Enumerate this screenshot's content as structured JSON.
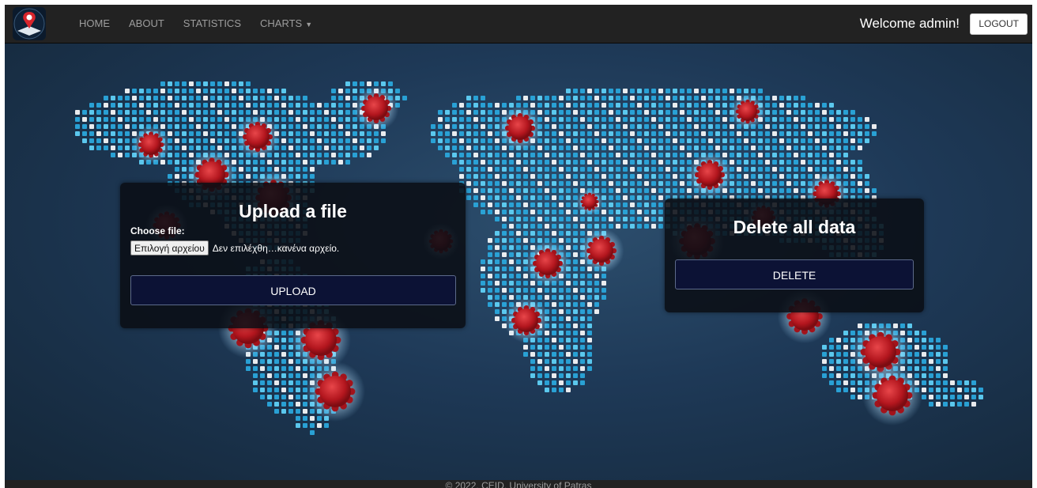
{
  "navbar": {
    "logo_label": "logo",
    "links": [
      {
        "label": "HOME"
      },
      {
        "label": "ABOUT"
      },
      {
        "label": "STATISTICS"
      },
      {
        "label": "CHARTS"
      }
    ],
    "welcome": "Welcome admin!",
    "logout_label": "LOGOUT"
  },
  "upload": {
    "title": "Upload a file",
    "choose_label": "Choose file:",
    "file_button": "Επιλογή αρχείου",
    "file_status": "Δεν επιλέχθη…κανένα αρχείο.",
    "submit_label": "UPLOAD"
  },
  "delete": {
    "title": "Delete all data",
    "submit_label": "DELETE"
  },
  "footer": {
    "text": "© 2022, CEID, University of Patras"
  },
  "colors": {
    "navbar": "#222222",
    "map_dots": "#2bb4e6",
    "virus": "#c0202a",
    "button_bg": "#0c1235"
  }
}
